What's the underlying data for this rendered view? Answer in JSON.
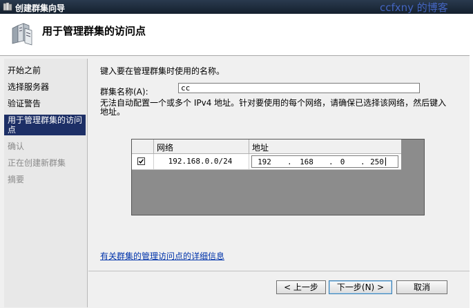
{
  "window": {
    "title": "创建群集向导",
    "watermark": "ccfxny 的博客"
  },
  "header": {
    "title": "用于管理群集的访问点"
  },
  "nav": {
    "items": [
      {
        "label": "开始之前",
        "state": "normal"
      },
      {
        "label": "选择服务器",
        "state": "normal"
      },
      {
        "label": "验证警告",
        "state": "normal"
      },
      {
        "label": "用于管理群集的访问点",
        "label_line1": "用于管理群集的访问",
        "label_line2": "点",
        "state": "active"
      },
      {
        "label": "确认",
        "state": "disabled"
      },
      {
        "label": "正在创建新群集",
        "state": "disabled"
      },
      {
        "label": "摘要",
        "state": "disabled"
      }
    ]
  },
  "main": {
    "instruction": "键入要在管理群集时使用的名称。",
    "cluster_name_label": "群集名称(A):",
    "cluster_name_value": "cc",
    "notice_line1": "无法自动配置一个或多个 IPv4 地址。针对要使用的每个网络，请确保已选择该网络，然后键入",
    "notice_line2": "地址。",
    "grid": {
      "columns": [
        "网络",
        "地址"
      ],
      "rows": [
        {
          "checked": true,
          "network": "192.168.0.0/24",
          "address": [
            "192",
            "168",
            "0",
            "250"
          ]
        }
      ]
    },
    "link": "有关群集的管理访问点的详细信息"
  },
  "buttons": {
    "back": "< 上一步",
    "next": "下一步(N) >",
    "cancel": "取消"
  },
  "colors": {
    "title_bar": "#1c2a3a",
    "active_nav": "#1d2f66",
    "link": "#0033aa",
    "watermark": "#4a6fd8"
  }
}
